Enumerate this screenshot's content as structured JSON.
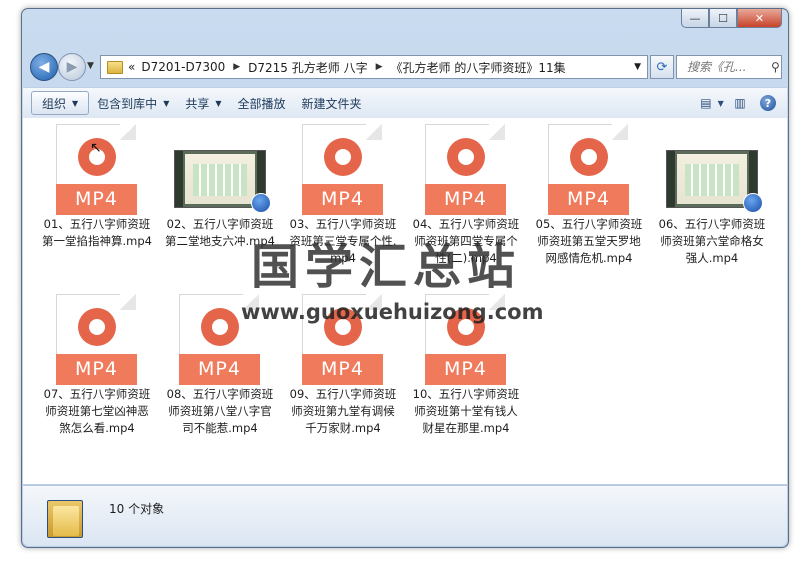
{
  "window": {
    "controls": {
      "minimize": "—",
      "maximize": "☐",
      "close": "✕"
    }
  },
  "nav": {
    "back_icon": "◀",
    "forward_icon": "▶",
    "dropdown": "▼",
    "breadcrumbs": [
      "«",
      "D7201-D7300",
      "D7215 孔方老师 八字",
      "《孔方老师 的八字师资班》11集"
    ],
    "refresh_icon": "⟳",
    "search_placeholder": "搜索《孔...",
    "search_icon": "⚲"
  },
  "toolbar": {
    "organize": "组织",
    "include_in_library": "包含到库中",
    "share": "共享",
    "play_all": "全部播放",
    "new_folder": "新建文件夹",
    "view_icon": "▤",
    "pane_icon": "▥",
    "help": "?"
  },
  "files": [
    {
      "name": "01、五行八字师资班第一堂掐指神算.mp4",
      "type": "mp4",
      "icon_text": "MP4"
    },
    {
      "name": "02、五行八字师资班第二堂地支六冲.mp4",
      "type": "video-thumb",
      "icon_text": ""
    },
    {
      "name": "03、五行八字师资班资班第三堂专属个性.mp4",
      "type": "mp4",
      "icon_text": "MP4"
    },
    {
      "name": "04、五行八字师资班师资班第四堂专属个性(二).mp4",
      "type": "mp4",
      "icon_text": "MP4"
    },
    {
      "name": "05、五行八字师资班师资班第五堂天罗地网感情危机.mp4",
      "type": "mp4",
      "icon_text": "MP4"
    },
    {
      "name": "06、五行八字师资班师资班第六堂命格女强人.mp4",
      "type": "video-thumb",
      "icon_text": ""
    },
    {
      "name": "07、五行八字师资班师资班第七堂凶神恶煞怎么看.mp4",
      "type": "mp4",
      "icon_text": "MP4"
    },
    {
      "name": "08、五行八字师资班师资班第八堂八字官司不能惹.mp4",
      "type": "mp4",
      "icon_text": "MP4"
    },
    {
      "name": "09、五行八字师资班师资班第九堂有调候千万家财.mp4",
      "type": "mp4",
      "icon_text": "MP4"
    },
    {
      "name": "10、五行八字师资班师资班第十堂有钱人财星在那里.mp4",
      "type": "mp4",
      "icon_text": "MP4"
    }
  ],
  "status": {
    "item_count": "10 个对象"
  },
  "watermark": {
    "title": "国学汇总站",
    "url": "www.guoxuehuizong.com"
  },
  "colors": {
    "mp4_band": "#f07a5c",
    "mp4_circle": "#e5654a",
    "chrome": "#b8cde8"
  }
}
